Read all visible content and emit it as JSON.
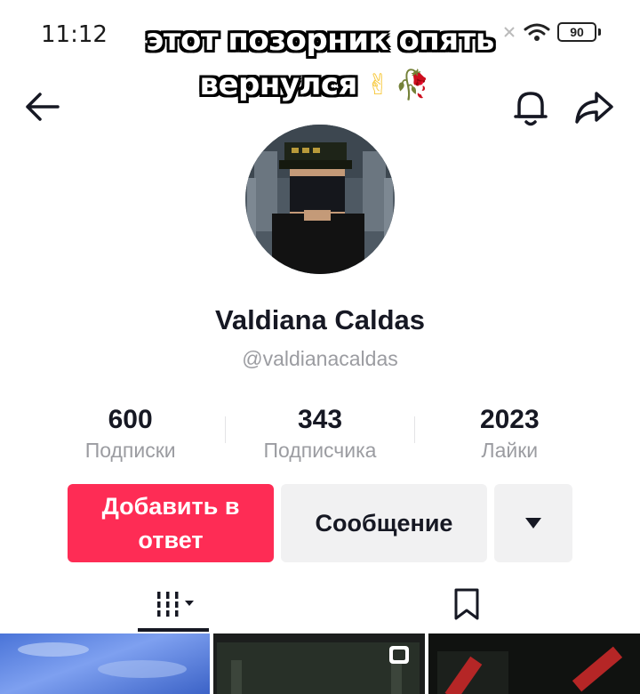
{
  "status_bar": {
    "time": "11:12",
    "battery": "90"
  },
  "caption": {
    "line1": "этот позорник опять",
    "line2": "вернулся",
    "emoji_hand": "✌",
    "emoji_rose": "🥀"
  },
  "profile": {
    "display_name": "Valdiana Caldas",
    "handle": "@valdianacaldas"
  },
  "stats": [
    {
      "value": "600",
      "label": "Подписки"
    },
    {
      "value": "343",
      "label": "Подписчика"
    },
    {
      "value": "2023",
      "label": "Лайки"
    }
  ],
  "actions": {
    "follow_label": "Добавить в ответ",
    "message_label": "Сообщение"
  },
  "colors": {
    "accent": "#fe2c55",
    "secondary_button": "#f1f1f2",
    "text_primary": "#161823",
    "text_secondary": "#9b9ca1"
  },
  "icons": {
    "back": "arrow-left-icon",
    "bell": "bell-icon",
    "share": "share-arrow-icon",
    "more": "triangle-down-icon",
    "videos_tab": "grid-bars-icon",
    "saved_tab": "bookmark-icon"
  }
}
